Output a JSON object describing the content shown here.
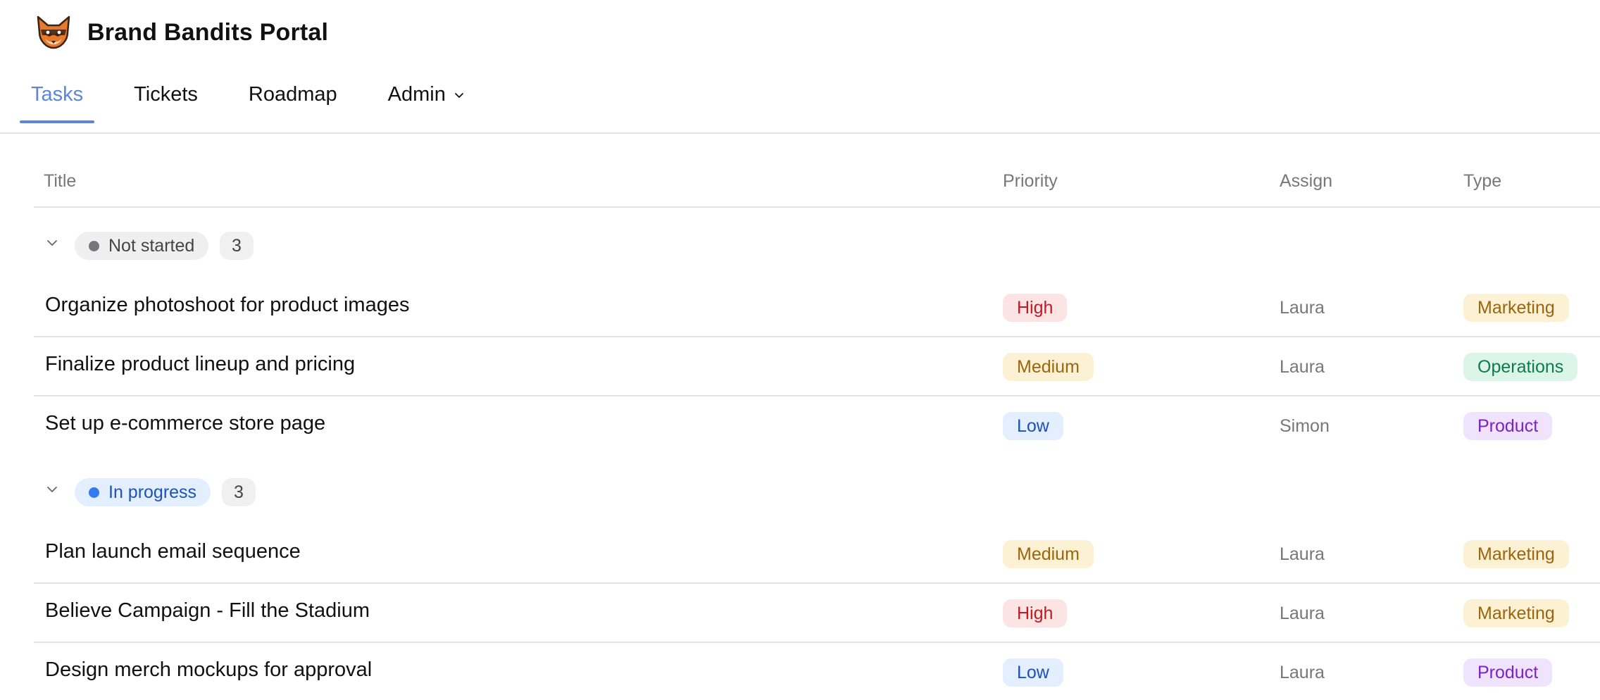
{
  "app": {
    "title": "Brand Bandits Portal",
    "logo": "fox-logo"
  },
  "tabs": [
    {
      "label": "Tasks",
      "active": true
    },
    {
      "label": "Tickets",
      "active": false
    },
    {
      "label": "Roadmap",
      "active": false
    },
    {
      "label": "Admin",
      "active": false,
      "icon": "chevron-down-icon"
    }
  ],
  "table": {
    "columns": {
      "title": "Title",
      "priority": "Priority",
      "assign": "Assign",
      "type": "Type"
    },
    "groups": [
      {
        "status": "Not started",
        "count": "3",
        "status_color": "#77767b",
        "pill_bg": "#efefef",
        "pill_text": "#444444",
        "rows": [
          {
            "title": "Organize photoshoot for product images",
            "priority": "High",
            "assign": "Laura",
            "type": "Marketing"
          },
          {
            "title": "Finalize product lineup and pricing",
            "priority": "Medium",
            "assign": "Laura",
            "type": "Operations"
          },
          {
            "title": "Set up e-commerce store page",
            "priority": "Low",
            "assign": "Simon",
            "type": "Product"
          }
        ]
      },
      {
        "status": "In progress",
        "count": "3",
        "status_color": "#3479ee",
        "pill_bg": "#e3efff",
        "pill_text": "#1b53b8",
        "rows": [
          {
            "title": "Plan launch email sequence",
            "priority": "Medium",
            "assign": "Laura",
            "type": "Marketing"
          },
          {
            "title": "Believe Campaign - Fill the Stadium",
            "priority": "High",
            "assign": "Laura",
            "type": "Marketing"
          },
          {
            "title": "Design merch mockups for approval",
            "priority": "Low",
            "assign": "Laura",
            "type": "Product"
          }
        ]
      }
    ]
  },
  "colors": {
    "accent": "#5b86d9",
    "priority": {
      "High": {
        "bg": "#fde4e4",
        "fg": "#c01a24"
      },
      "Medium": {
        "bg": "#fdf1d3",
        "fg": "#9a6510"
      },
      "Low": {
        "bg": "#e3eefe",
        "fg": "#1f4fbd"
      }
    },
    "type": {
      "Marketing": {
        "bg": "#fdf1d3",
        "fg": "#9a6510"
      },
      "Operations": {
        "bg": "#dcf5e9",
        "fg": "#0e7a4d"
      },
      "Product": {
        "bg": "#efe3fd",
        "fg": "#7a23c9"
      }
    }
  }
}
